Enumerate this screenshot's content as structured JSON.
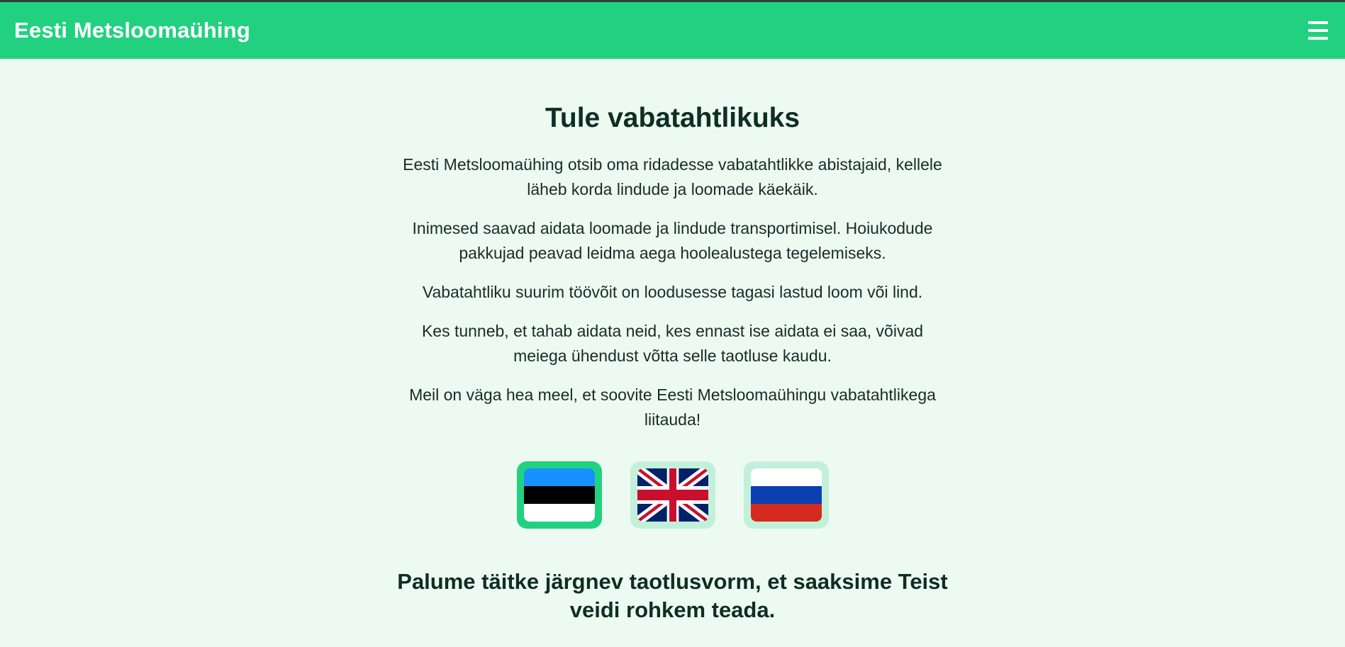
{
  "header": {
    "brand": "Eesti Metsloomaühing",
    "menu_icon": "hamburger-menu-icon"
  },
  "main": {
    "title": "Tule vabatahtlikuks",
    "paragraphs": [
      "Eesti Metsloomaühing otsib oma ridadesse vabatahtlikke abistajaid, kellele läheb korda lindude ja loomade käekäik.",
      "Inimesed saavad aidata loomade ja lindude transportimisel. Hoiukodude pakkujad peavad leidma aega hoolealustega tegelemiseks.",
      "Vabatahtliku suurim töövõit on loodusesse tagasi lastud loom või lind.",
      "Kes tunneb, et tahab aidata neid, kes ennast ise aidata ei saa, võivad meiega ühendust võtta selle taotluse kaudu.",
      "Meil on väga hea meel, et soovite Eesti Metsloomaühingu vabatahtlikega liitauda!"
    ],
    "languages": [
      {
        "code": "et",
        "icon": "estonian-flag-icon",
        "selected": true
      },
      {
        "code": "en",
        "icon": "uk-flag-icon",
        "selected": false
      },
      {
        "code": "ru",
        "icon": "russian-flag-icon",
        "selected": false
      }
    ],
    "form_heading": "Palume täitke järgnev taotlusvorm, et saaksime Teist veidi rohkem teada."
  },
  "colors": {
    "accent": "#22d180",
    "background": "#ecfaf2",
    "flag_inactive_bg": "#c3f0da",
    "text_dark": "#0f2e22"
  }
}
